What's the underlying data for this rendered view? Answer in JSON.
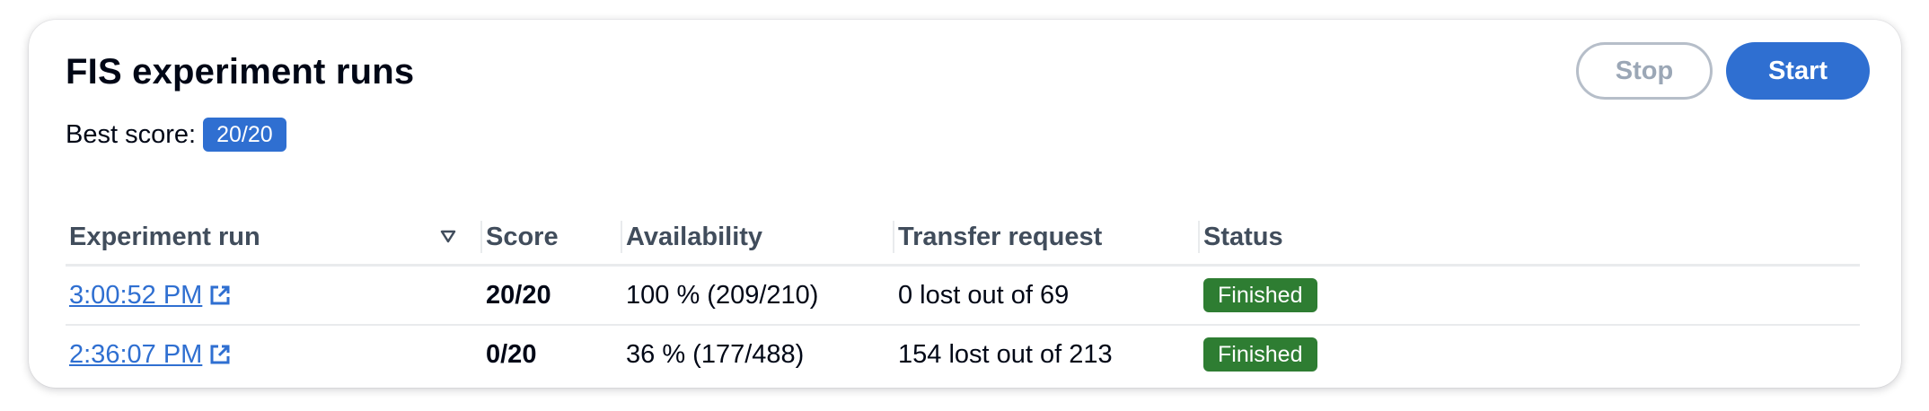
{
  "header": {
    "title": "FIS experiment runs",
    "best_score_label": "Best score:",
    "best_score_value": "20/20"
  },
  "actions": {
    "stop_label": "Stop",
    "start_label": "Start"
  },
  "table": {
    "columns": [
      "Experiment run",
      "Score",
      "Availability",
      "Transfer request",
      "Status"
    ],
    "rows": [
      {
        "run": "3:00:52 PM",
        "score": "20/20",
        "availability": "100 % (209/210)",
        "transfer": "0 lost out of 69",
        "status": "Finished"
      },
      {
        "run": "2:36:07 PM",
        "score": "0/20",
        "availability": "36 % (177/488)",
        "transfer": "154 lost out of 213",
        "status": "Finished"
      }
    ]
  },
  "colors": {
    "accent": "#2f6fd1",
    "status_finished": "#2e7d32",
    "disabled_border": "#b6bec9"
  },
  "icons": {
    "sort": "sort-descending-icon",
    "external_link": "external-link-icon"
  }
}
